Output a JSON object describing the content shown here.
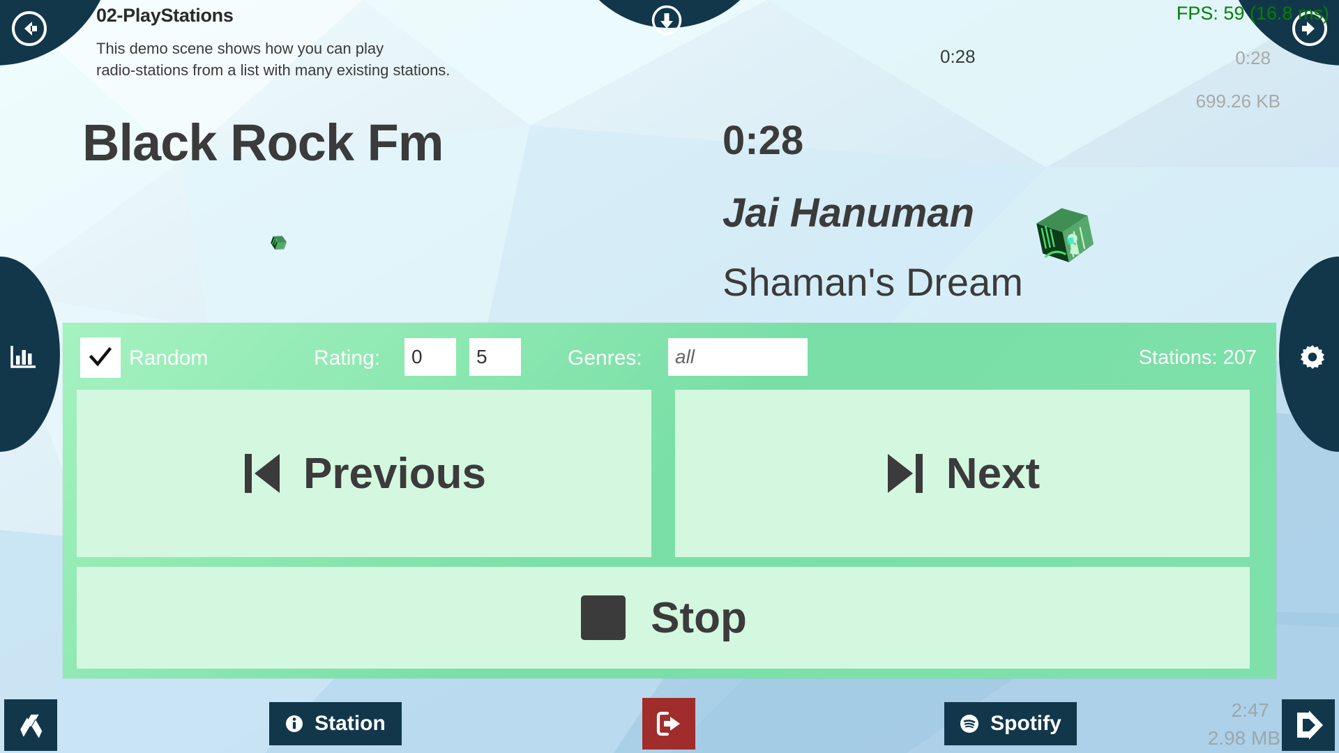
{
  "scene": {
    "title": "02-PlayStations",
    "description": "This demo scene shows how you can play\nradio-stations from a list with many existing stations."
  },
  "stats_overlay": {
    "fps": "FPS: 59 (16.8 ms)",
    "fps_color": "#028002",
    "time_right": "0:28",
    "downloaded": "699.26 KB",
    "bottom_time": "2:47",
    "bottom_memory": "2.98 MB",
    "dim_color": "#a9a9a9"
  },
  "player": {
    "elapsed_top": "0:28",
    "station_name": "Black Rock Fm",
    "track_time": "0:28",
    "track_title": "Jai Hanuman",
    "track_artist": "Shaman's Dream"
  },
  "controls": {
    "random_label": "Random",
    "random_checked": true,
    "rating_label": "Rating:",
    "rating_min": "0",
    "rating_max": "5",
    "genres_label": "Genres:",
    "genres_value": "",
    "genres_placeholder": "all",
    "stations_count": "Stations: 207",
    "previous_label": "Previous",
    "next_label": "Next",
    "stop_label": "Stop",
    "panel_accent": "#7fe0ab",
    "button_fill": "#d4f7e0"
  },
  "bottom_bar": {
    "station_label": "Station",
    "spotify_label": "Spotify",
    "exit_color": "#a02c2c",
    "bar_color": "#12374b"
  },
  "nav": {
    "back_icon": "arrow-left-circle-icon",
    "forward_icon": "arrow-right-circle-icon",
    "download_icon": "arrow-down-circle-icon",
    "stats_icon": "bar-chart-icon",
    "settings_icon": "gear-icon"
  }
}
